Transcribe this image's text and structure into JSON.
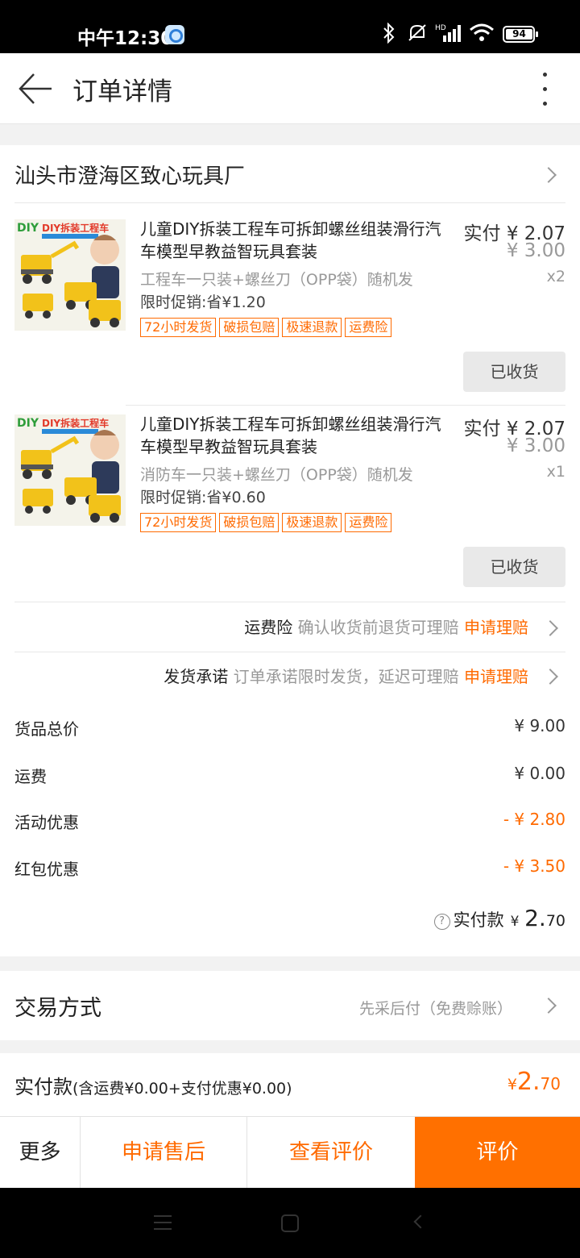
{
  "status_bar": {
    "time": "中午12:30",
    "battery": "94"
  },
  "header": {
    "title": "订单详情"
  },
  "shop": {
    "name": "汕头市澄海区致心玩具厂"
  },
  "items": [
    {
      "name": "儿童DIY拆装工程车可拆卸螺丝组装滑行汽车模型早教益智玩具套装",
      "sku": "工程车一只装+螺丝刀（OPP袋）随机发",
      "promo": "限时促销:省¥1.20",
      "tags": [
        "72小时发货",
        "破损包赔",
        "极速退款",
        "运费险"
      ],
      "paid_price": "实付 ¥ 2.07",
      "original_price": "¥ 3.00",
      "qty": "x2",
      "button": "已收货",
      "thumb_banner": "DIY拆装工程车"
    },
    {
      "name": "儿童DIY拆装工程车可拆卸螺丝组装滑行汽车模型早教益智玩具套装",
      "sku": "消防车一只装+螺丝刀（OPP袋）随机发",
      "promo": "限时促销:省¥0.60",
      "tags": [
        "72小时发货",
        "破损包赔",
        "极速退款",
        "运费险"
      ],
      "paid_price": "实付 ¥ 2.07",
      "original_price": "¥ 3.00",
      "qty": "x1",
      "button": "已收货",
      "thumb_banner": "DIY拆装工程车"
    }
  ],
  "services": [
    {
      "name": "运费险",
      "desc": "确认收货前退货可理赔",
      "link": "申请理赔"
    },
    {
      "name": "发货承诺",
      "desc": "订单承诺限时发货，延迟可理赔",
      "link": "申请理赔"
    }
  ],
  "fees": [
    {
      "label": "货品总价",
      "value": "¥ 9.00",
      "color": "#333333"
    },
    {
      "label": "运费",
      "value": "¥ 0.00",
      "color": "#333333"
    },
    {
      "label": "活动优惠",
      "value": "- ¥ 2.80",
      "color": "#ff6a00"
    },
    {
      "label": "红包优惠",
      "value": "- ¥ 3.50",
      "color": "#ff6a00"
    }
  ],
  "total": {
    "label": "实付款",
    "currency": "¥",
    "integer": "2.",
    "decimal": "70"
  },
  "trade": {
    "label": "交易方式",
    "value": "先采后付（免费赊账）"
  },
  "paid_summary": {
    "label": "实付款",
    "detail": "(含运费¥0.00+支付优惠¥0.00)",
    "currency": "¥",
    "integer": "2.",
    "decimal": "70"
  },
  "bottom_bar": {
    "more": "更多",
    "after_sale": "申请售后",
    "view_review": "查看评价",
    "review": "评价"
  },
  "colors": {
    "accent": "#ff6a00",
    "primary_button": "#ff7000"
  }
}
